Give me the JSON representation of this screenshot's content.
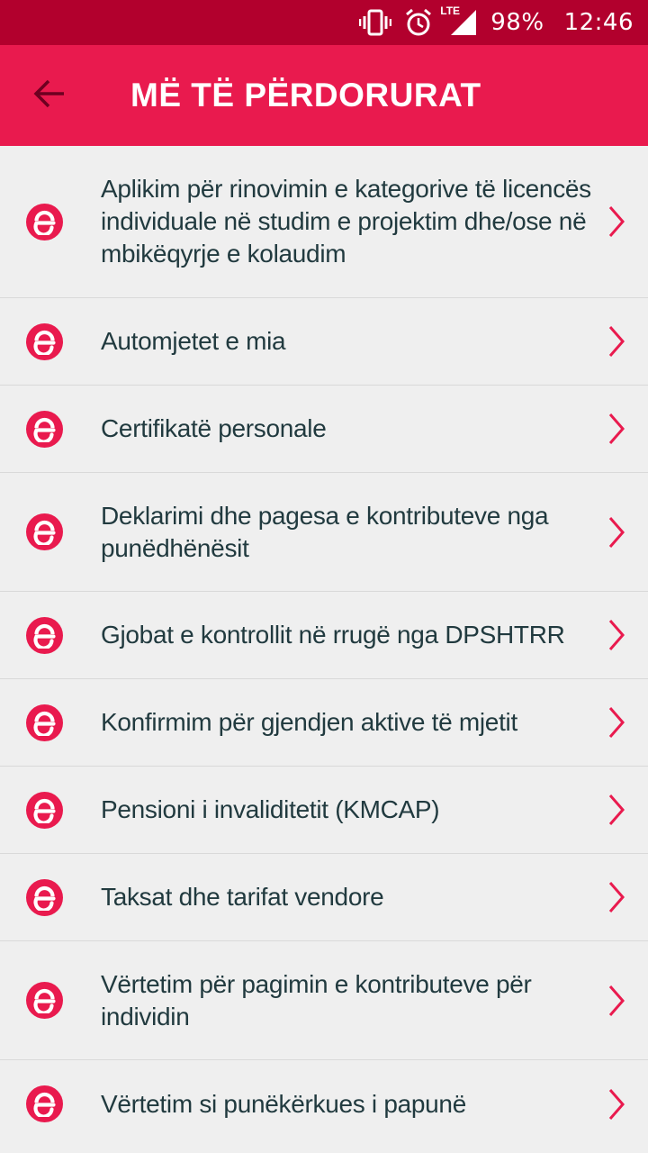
{
  "status_bar": {
    "battery_percent": "98%",
    "time": "12:46",
    "network_label": "LTE",
    "icons": [
      "vibrate-icon",
      "alarm-icon",
      "signal-icon"
    ]
  },
  "app_bar": {
    "title": "MË TË PËRDORURAT",
    "back_icon": "arrow-back-icon"
  },
  "colors": {
    "status_bar": "#b2002d",
    "accent": "#e91a4e",
    "background": "#efefef",
    "text": "#213a3f"
  },
  "items": [
    {
      "label": "Aplikim për rinovimin e kategorive të licencës individuale në studim e projektim dhe/ose në mbikëqyrje e kolaudim"
    },
    {
      "label": "Automjetet e mia"
    },
    {
      "label": "Certifikatë personale"
    },
    {
      "label": "Deklarimi dhe pagesa e kontributeve nga punëdhënësit"
    },
    {
      "label": "Gjobat e kontrollit në rrugë nga DPSHTRR"
    },
    {
      "label": "Konfirmim për gjendjen aktive të mjetit"
    },
    {
      "label": "Pensioni i invaliditetit (KMCAP)"
    },
    {
      "label": "Taksat dhe tarifat vendore"
    },
    {
      "label": "Vërtetim për pagimin e kontributeve për individin"
    },
    {
      "label": "Vërtetim si punëkërkues i papunë"
    }
  ]
}
